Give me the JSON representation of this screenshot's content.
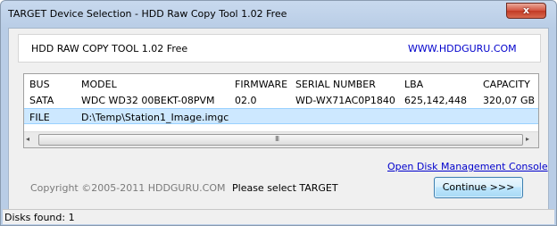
{
  "window": {
    "title": "TARGET Device Selection - HDD Raw Copy Tool 1.02   Free",
    "close_glyph": "x"
  },
  "header": {
    "app_name": "HDD RAW COPY TOOL 1.02   Free",
    "website": "WWW.HDDGURU.COM"
  },
  "table": {
    "columns": [
      "BUS",
      "MODEL",
      "FIRMWARE",
      "SERIAL NUMBER",
      "LBA",
      "CAPACITY"
    ],
    "rows": [
      {
        "bus": "SATA",
        "model": "WDC WD32 00BEKT-08PVM",
        "firmware": "02.0",
        "serial": "WD-WX71AC0P1840",
        "lba": "625,142,448",
        "capacity": "320,07 GB"
      },
      {
        "bus": "FILE",
        "model": "D:\\Temp\\Station1_Image.imgc",
        "firmware": "",
        "serial": "",
        "lba": "",
        "capacity": ""
      }
    ],
    "selected_row": 1,
    "scroll": {
      "left_arrow": "◂",
      "right_arrow": "▸",
      "grip": "III"
    }
  },
  "links": {
    "disk_management": "Open Disk Management Console"
  },
  "footer": {
    "copyright": "Copyright ©2005-2011 HDDGURU.COM",
    "status_message": "Please select TARGET",
    "continue_label": "Continue >>>"
  },
  "statusbar": {
    "disks_found": "Disks found: 1"
  },
  "colors": {
    "selection": "#cde8ff",
    "link": "#0000cc",
    "titlebar": "#b9cde6"
  }
}
